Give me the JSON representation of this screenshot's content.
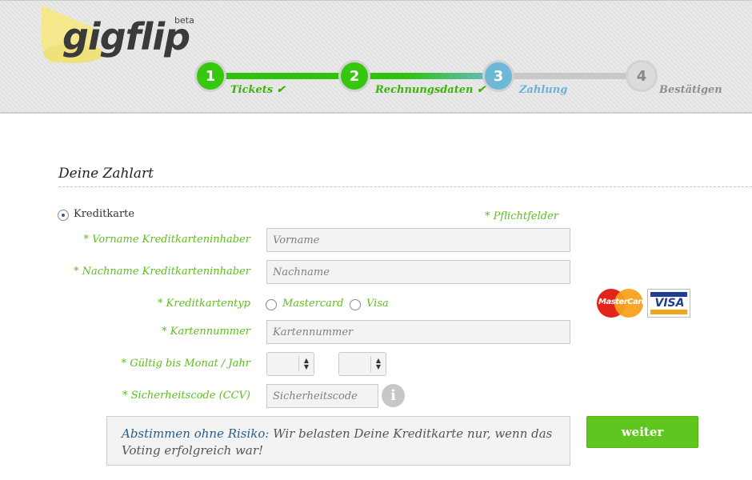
{
  "header": {
    "logo_text": "gigflip",
    "beta_label": "beta"
  },
  "steps": [
    {
      "number": "1",
      "label": "Tickets",
      "status": "done",
      "check": "✔"
    },
    {
      "number": "2",
      "label": "Rechnungsdaten",
      "status": "done",
      "check": "✔"
    },
    {
      "number": "3",
      "label": "Zahlung",
      "status": "active",
      "check": ""
    },
    {
      "number": "4",
      "label": "Bestätigen",
      "status": "todo",
      "check": ""
    }
  ],
  "payment": {
    "section_title": "Deine Zahlart",
    "method_label": "Kreditkarte",
    "required_note": "* Pflichtfelder",
    "fields": {
      "firstname_label": "* Vorname Kreditkarteninhaber",
      "firstname_placeholder": "Vorname",
      "lastname_label": "* Nachname Kreditkarteninhaber",
      "lastname_placeholder": "Nachname",
      "cardtype_label": "* Kreditkartentyp",
      "cardtype_options": [
        "Mastercard",
        "Visa"
      ],
      "cardnumber_label": "* Kartennummer",
      "cardnumber_placeholder": "Kartennummer",
      "expiry_label": "* Gültig bis Monat / Jahr",
      "ccv_label": "* Sicherheitscode (CCV)",
      "ccv_placeholder": "Sicherheitscode",
      "info_glyph": "i"
    },
    "card_logos": {
      "mastercard": "MasterCard",
      "visa": "VISA"
    },
    "notice": {
      "strong": "Abstimmen ohne Risiko",
      "text": ": Wir belasten Deine Kreditkarte nur, wenn das Voting erfolgreich war!"
    },
    "submit_label": "weiter"
  },
  "colors": {
    "green": "#5ec61e",
    "blue": "#6cb8d6",
    "notice_blue": "#2b5c88"
  }
}
